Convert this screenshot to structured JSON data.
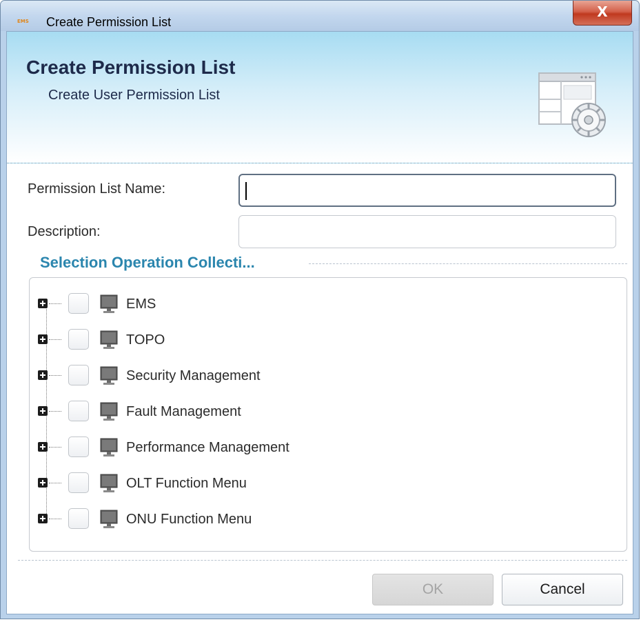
{
  "window": {
    "logo_text": "EMS",
    "title": "Create Permission List",
    "close_glyph": "X"
  },
  "header": {
    "title": "Create Permission List",
    "subtitle": "Create User Permission List",
    "icon": "permission-settings-icon"
  },
  "form": {
    "name_label": "Permission List Name:",
    "name_value": "",
    "description_label": "Description:",
    "description_value": ""
  },
  "section": {
    "title": "Selection Operation Collecti..."
  },
  "tree": {
    "node_icon": "monitor-icon",
    "items": [
      {
        "label": "EMS",
        "checked": false,
        "expanded": false
      },
      {
        "label": "TOPO",
        "checked": false,
        "expanded": false
      },
      {
        "label": "Security Management",
        "checked": false,
        "expanded": false
      },
      {
        "label": "Fault Management",
        "checked": false,
        "expanded": false
      },
      {
        "label": "Performance Management",
        "checked": false,
        "expanded": false
      },
      {
        "label": "OLT Function Menu",
        "checked": false,
        "expanded": false
      },
      {
        "label": "ONU Function Menu",
        "checked": false,
        "expanded": false
      }
    ]
  },
  "buttons": {
    "ok_label": "OK",
    "ok_enabled": false,
    "cancel_label": "Cancel"
  }
}
